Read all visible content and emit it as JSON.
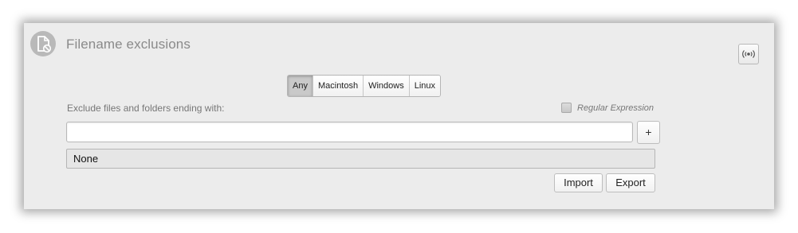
{
  "header": {
    "title": "Filename exclusions",
    "icon": "document-blocked-icon",
    "broadcast_icon": "broadcast-icon"
  },
  "platform_tabs": [
    {
      "label": "Any",
      "active": true
    },
    {
      "label": "Macintosh",
      "active": false
    },
    {
      "label": "Windows",
      "active": false
    },
    {
      "label": "Linux",
      "active": false
    }
  ],
  "form": {
    "label": "Exclude files and folders ending with:",
    "regex_label": "Regular Expression",
    "regex_checked": false,
    "input_value": "",
    "add_label": "+"
  },
  "list": {
    "items": [
      "None"
    ]
  },
  "actions": {
    "import_label": "Import",
    "export_label": "Export"
  }
}
